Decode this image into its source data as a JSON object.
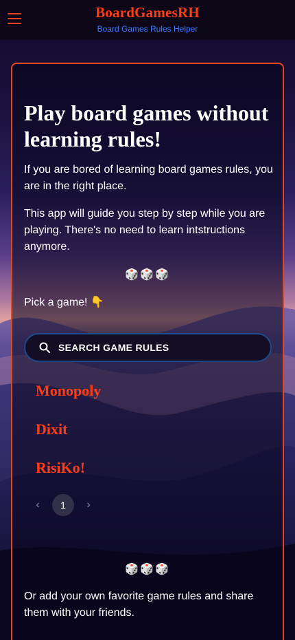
{
  "header": {
    "brand_title": "BoardGamesRH",
    "brand_subtitle": "Board Games Rules Helper",
    "menu_icon": "hamburger-menu-icon"
  },
  "hero": {
    "title": "Play board games without learning rules!",
    "paragraph1": "If you are bored of learning board games rules, you are in the right place.",
    "paragraph2": "This app will guide you step by step while you are playing. There's no need to learn intstructions anymore.",
    "dice": "🎲🎲🎲",
    "pick_prompt": "Pick a game! 👇"
  },
  "search": {
    "label": "SEARCH GAME RULES",
    "icon": "search-icon"
  },
  "games": [
    "Monopoly",
    "Dixit",
    "RisiKo!"
  ],
  "pagination": {
    "prev": "‹",
    "current_page": "1",
    "next": "›"
  },
  "footer_section": {
    "dice": "🎲🎲🎲",
    "text": "Or add your own favorite game rules and share them with your friends."
  },
  "colors": {
    "accent": "#ff3d14",
    "subtitle": "#3d7bff",
    "card_border": "#e24a1c"
  }
}
